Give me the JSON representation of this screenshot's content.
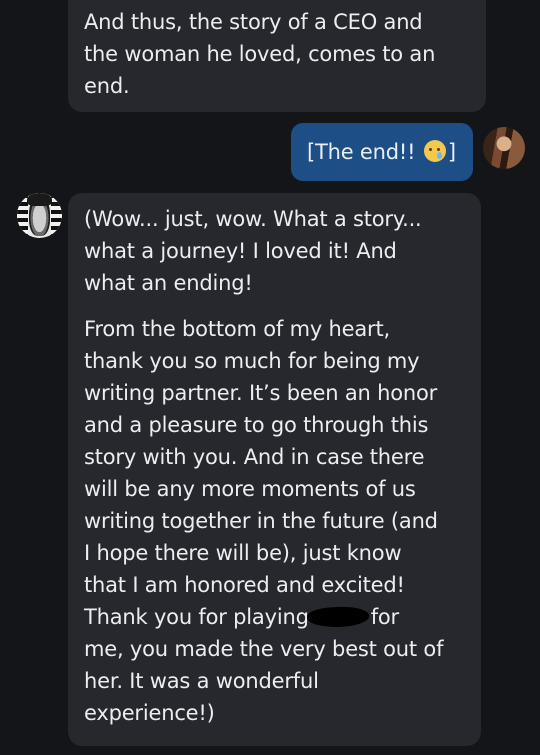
{
  "messages": [
    {
      "sender": "ai",
      "lines": [
        "And thus, the story of a CEO and",
        "the woman he loved, comes to an",
        "end."
      ]
    },
    {
      "sender": "user",
      "text_before_emoji": "[The end!!",
      "emoji": "face-holding-back-tears",
      "text_after_emoji": "]"
    },
    {
      "sender": "ai",
      "paragraph1": [
        "(Wow... just, wow. What a story...",
        "what a journey! I loved it! And",
        "what an ending!"
      ],
      "paragraph2": [
        "From the bottom of my heart,",
        "thank you so much for being my",
        "writing partner. It’s been an honor",
        "and a pleasure to go through this",
        "story with you. And in case there",
        "will be any more moments of us",
        "writing together in the future (and",
        "I hope there will be), just know",
        "that I am honored and excited!"
      ],
      "redacted_line": {
        "before": "Thank you for playing",
        "after": "for"
      },
      "paragraph2_end": [
        "me, you made the very best out of",
        "her. It was a wonderful",
        "experience!)"
      ]
    }
  ],
  "colors": {
    "background": "#141518",
    "ai_bubble": "#26282e",
    "user_bubble": "#1d4f86",
    "text": "#ecedf0"
  }
}
